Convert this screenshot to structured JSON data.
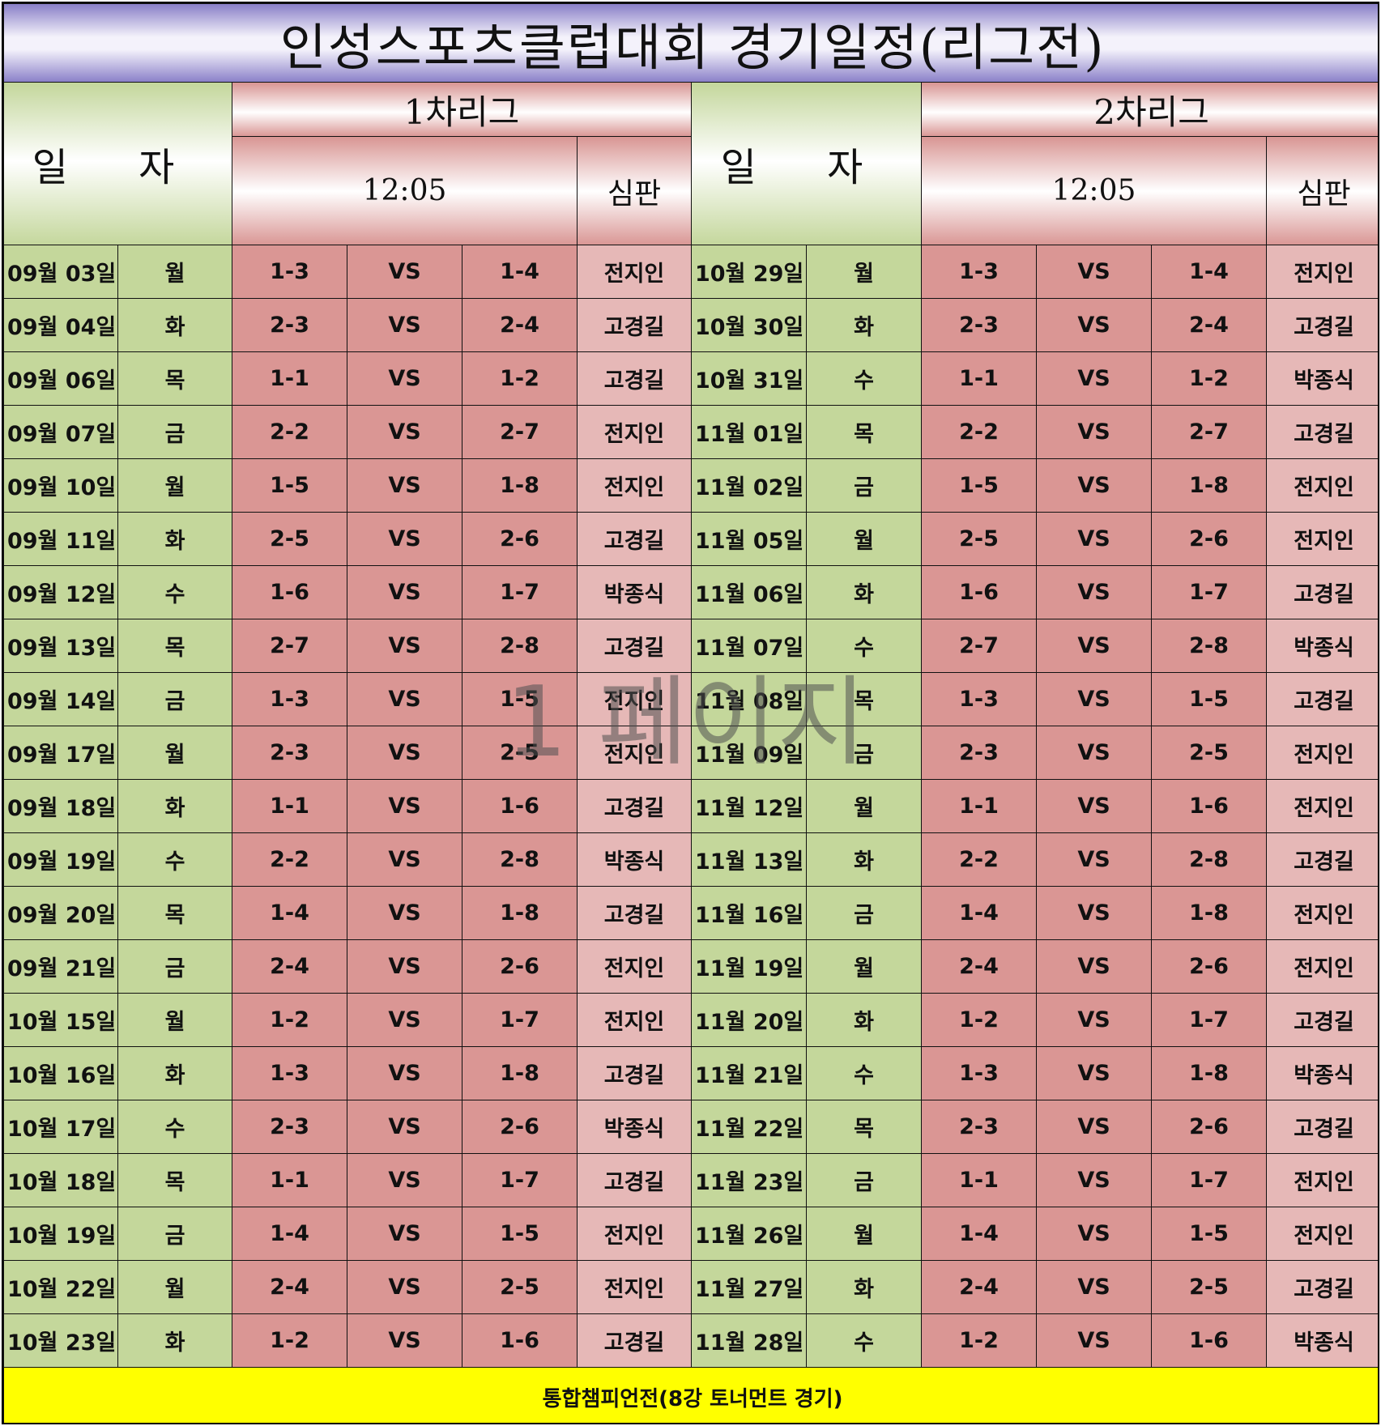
{
  "title": "인성스포츠클럽대회 경기일정(리그전)",
  "header": {
    "date_label": "일 자",
    "league1": "1차리그",
    "league2": "2차리그",
    "time1": "12:05",
    "time2": "12:05",
    "referee1": "심판",
    "referee2": "심판"
  },
  "rows": [
    {
      "l": {
        "date": "09월 03일",
        "day": "월",
        "home": "1-3",
        "vs": "VS",
        "away": "1-4",
        "ref": "전지인"
      },
      "r": {
        "date": "10월 29일",
        "day": "월",
        "home": "1-3",
        "vs": "VS",
        "away": "1-4",
        "ref": "전지인"
      }
    },
    {
      "l": {
        "date": "09월 04일",
        "day": "화",
        "home": "2-3",
        "vs": "VS",
        "away": "2-4",
        "ref": "고경길"
      },
      "r": {
        "date": "10월 30일",
        "day": "화",
        "home": "2-3",
        "vs": "VS",
        "away": "2-4",
        "ref": "고경길"
      }
    },
    {
      "l": {
        "date": "09월 06일",
        "day": "목",
        "home": "1-1",
        "vs": "VS",
        "away": "1-2",
        "ref": "고경길"
      },
      "r": {
        "date": "10월 31일",
        "day": "수",
        "home": "1-1",
        "vs": "VS",
        "away": "1-2",
        "ref": "박종식"
      }
    },
    {
      "l": {
        "date": "09월 07일",
        "day": "금",
        "home": "2-2",
        "vs": "VS",
        "away": "2-7",
        "ref": "전지인"
      },
      "r": {
        "date": "11월 01일",
        "day": "목",
        "home": "2-2",
        "vs": "VS",
        "away": "2-7",
        "ref": "고경길"
      }
    },
    {
      "l": {
        "date": "09월 10일",
        "day": "월",
        "home": "1-5",
        "vs": "VS",
        "away": "1-8",
        "ref": "전지인"
      },
      "r": {
        "date": "11월 02일",
        "day": "금",
        "home": "1-5",
        "vs": "VS",
        "away": "1-8",
        "ref": "전지인"
      }
    },
    {
      "l": {
        "date": "09월 11일",
        "day": "화",
        "home": "2-5",
        "vs": "VS",
        "away": "2-6",
        "ref": "고경길"
      },
      "r": {
        "date": "11월 05일",
        "day": "월",
        "home": "2-5",
        "vs": "VS",
        "away": "2-6",
        "ref": "전지인"
      }
    },
    {
      "l": {
        "date": "09월 12일",
        "day": "수",
        "home": "1-6",
        "vs": "VS",
        "away": "1-7",
        "ref": "박종식"
      },
      "r": {
        "date": "11월 06일",
        "day": "화",
        "home": "1-6",
        "vs": "VS",
        "away": "1-7",
        "ref": "고경길"
      }
    },
    {
      "l": {
        "date": "09월 13일",
        "day": "목",
        "home": "2-7",
        "vs": "VS",
        "away": "2-8",
        "ref": "고경길"
      },
      "r": {
        "date": "11월 07일",
        "day": "수",
        "home": "2-7",
        "vs": "VS",
        "away": "2-8",
        "ref": "박종식"
      }
    },
    {
      "l": {
        "date": "09월 14일",
        "day": "금",
        "home": "1-3",
        "vs": "VS",
        "away": "1-5",
        "ref": "전지인"
      },
      "r": {
        "date": "11월 08일",
        "day": "목",
        "home": "1-3",
        "vs": "VS",
        "away": "1-5",
        "ref": "고경길"
      }
    },
    {
      "l": {
        "date": "09월 17일",
        "day": "월",
        "home": "2-3",
        "vs": "VS",
        "away": "2-5",
        "ref": "전지인"
      },
      "r": {
        "date": "11월 09일",
        "day": "금",
        "home": "2-3",
        "vs": "VS",
        "away": "2-5",
        "ref": "전지인"
      }
    },
    {
      "l": {
        "date": "09월 18일",
        "day": "화",
        "home": "1-1",
        "vs": "VS",
        "away": "1-6",
        "ref": "고경길"
      },
      "r": {
        "date": "11월 12일",
        "day": "월",
        "home": "1-1",
        "vs": "VS",
        "away": "1-6",
        "ref": "전지인"
      }
    },
    {
      "l": {
        "date": "09월 19일",
        "day": "수",
        "home": "2-2",
        "vs": "VS",
        "away": "2-8",
        "ref": "박종식"
      },
      "r": {
        "date": "11월 13일",
        "day": "화",
        "home": "2-2",
        "vs": "VS",
        "away": "2-8",
        "ref": "고경길"
      }
    },
    {
      "l": {
        "date": "09월 20일",
        "day": "목",
        "home": "1-4",
        "vs": "VS",
        "away": "1-8",
        "ref": "고경길"
      },
      "r": {
        "date": "11월 16일",
        "day": "금",
        "home": "1-4",
        "vs": "VS",
        "away": "1-8",
        "ref": "전지인"
      }
    },
    {
      "l": {
        "date": "09월 21일",
        "day": "금",
        "home": "2-4",
        "vs": "VS",
        "away": "2-6",
        "ref": "전지인"
      },
      "r": {
        "date": "11월 19일",
        "day": "월",
        "home": "2-4",
        "vs": "VS",
        "away": "2-6",
        "ref": "전지인"
      }
    },
    {
      "l": {
        "date": "10월 15일",
        "day": "월",
        "home": "1-2",
        "vs": "VS",
        "away": "1-7",
        "ref": "전지인"
      },
      "r": {
        "date": "11월 20일",
        "day": "화",
        "home": "1-2",
        "vs": "VS",
        "away": "1-7",
        "ref": "고경길"
      }
    },
    {
      "l": {
        "date": "10월 16일",
        "day": "화",
        "home": "1-3",
        "vs": "VS",
        "away": "1-8",
        "ref": "고경길"
      },
      "r": {
        "date": "11월 21일",
        "day": "수",
        "home": "1-3",
        "vs": "VS",
        "away": "1-8",
        "ref": "박종식"
      }
    },
    {
      "l": {
        "date": "10월 17일",
        "day": "수",
        "home": "2-3",
        "vs": "VS",
        "away": "2-6",
        "ref": "박종식"
      },
      "r": {
        "date": "11월 22일",
        "day": "목",
        "home": "2-3",
        "vs": "VS",
        "away": "2-6",
        "ref": "고경길"
      }
    },
    {
      "l": {
        "date": "10월 18일",
        "day": "목",
        "home": "1-1",
        "vs": "VS",
        "away": "1-7",
        "ref": "고경길"
      },
      "r": {
        "date": "11월 23일",
        "day": "금",
        "home": "1-1",
        "vs": "VS",
        "away": "1-7",
        "ref": "전지인"
      }
    },
    {
      "l": {
        "date": "10월 19일",
        "day": "금",
        "home": "1-4",
        "vs": "VS",
        "away": "1-5",
        "ref": "전지인"
      },
      "r": {
        "date": "11월 26일",
        "day": "월",
        "home": "1-4",
        "vs": "VS",
        "away": "1-5",
        "ref": "전지인"
      }
    },
    {
      "l": {
        "date": "10월 22일",
        "day": "월",
        "home": "2-4",
        "vs": "VS",
        "away": "2-5",
        "ref": "전지인"
      },
      "r": {
        "date": "11월 27일",
        "day": "화",
        "home": "2-4",
        "vs": "VS",
        "away": "2-5",
        "ref": "고경길"
      }
    },
    {
      "l": {
        "date": "10월 23일",
        "day": "화",
        "home": "1-2",
        "vs": "VS",
        "away": "1-6",
        "ref": "고경길"
      },
      "r": {
        "date": "11월 28일",
        "day": "수",
        "home": "1-2",
        "vs": "VS",
        "away": "1-6",
        "ref": "박종식"
      }
    }
  ],
  "footer": "통합챔피언전(8강 토너먼트 경기)",
  "watermark": "1 페이지"
}
